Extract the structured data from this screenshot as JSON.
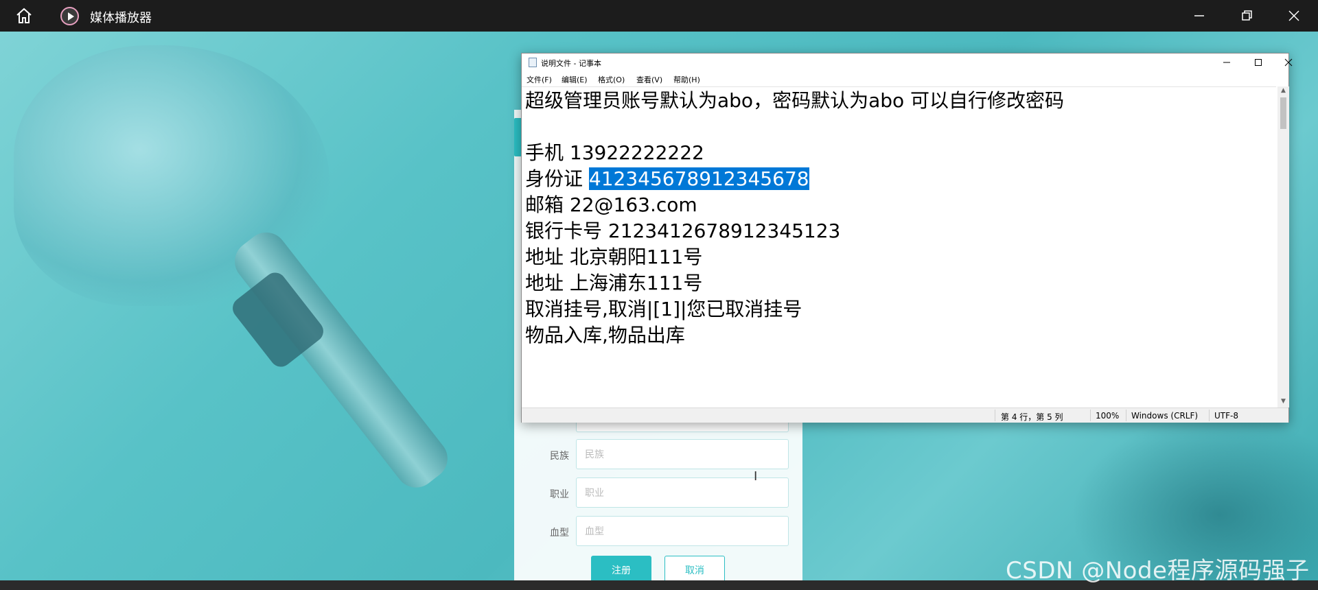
{
  "player": {
    "title": "媒体播放器"
  },
  "form": {
    "rows": [
      {
        "label": "民族",
        "placeholder": "民族"
      },
      {
        "label": "职业",
        "placeholder": "职业"
      },
      {
        "label": "血型",
        "placeholder": "血型"
      }
    ],
    "register_label": "注册",
    "cancel_label": "取消"
  },
  "notepad": {
    "title": "说明文件 - 记事本",
    "menu": [
      "文件(F)",
      "编辑(E)",
      "格式(O)",
      "查看(V)",
      "帮助(H)"
    ],
    "lines": [
      "超级管理员账号默认为abo，密码默认为abo 可以自行修改密码",
      "",
      "手机 13922222222",
      "身份证 ",
      "邮箱 22@163.com",
      "银行卡号 2123412678912345123",
      "地址 北京朝阳111号",
      "地址 上海浦东111号",
      "取消挂号,取消|[1]|您已取消挂号",
      "物品入库,物品出库"
    ],
    "selected_text": "412345678912345678",
    "status": {
      "position": "第 4 行，第 5 列",
      "zoom": "100%",
      "line_ending": "Windows (CRLF)",
      "encoding": "UTF-8"
    }
  },
  "watermark": "CSDN @Node程序源码强子",
  "colors": {
    "accent": "#2bbec3",
    "selection": "#0078d7"
  }
}
